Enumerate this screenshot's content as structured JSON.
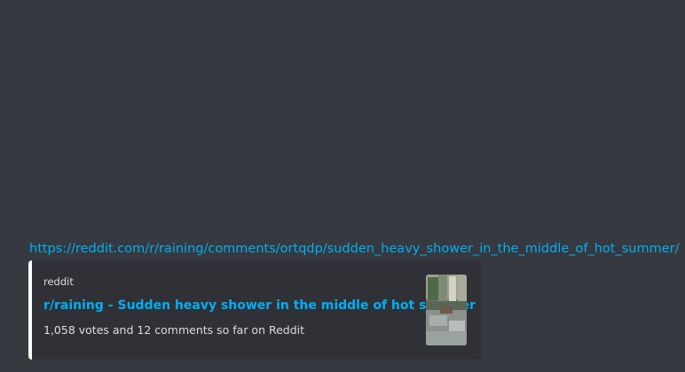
{
  "message": {
    "link_text": "https://reddit.com/r/raining/comments/ortqdp/sudden_heavy_shower_in_the_middle_of_hot_summer/"
  },
  "embed": {
    "provider": "reddit",
    "title": "r/raining - Sudden heavy shower in the middle of hot summer",
    "description": "1,058 votes and 12 comments so far on Reddit",
    "thumbnail": "rain-street-thumbnail-image",
    "accent_color": "#ffffff"
  },
  "colors": {
    "background": "#36393f",
    "embed_background": "#2f3136",
    "link": "#00aff4",
    "text": "#dcddde"
  }
}
